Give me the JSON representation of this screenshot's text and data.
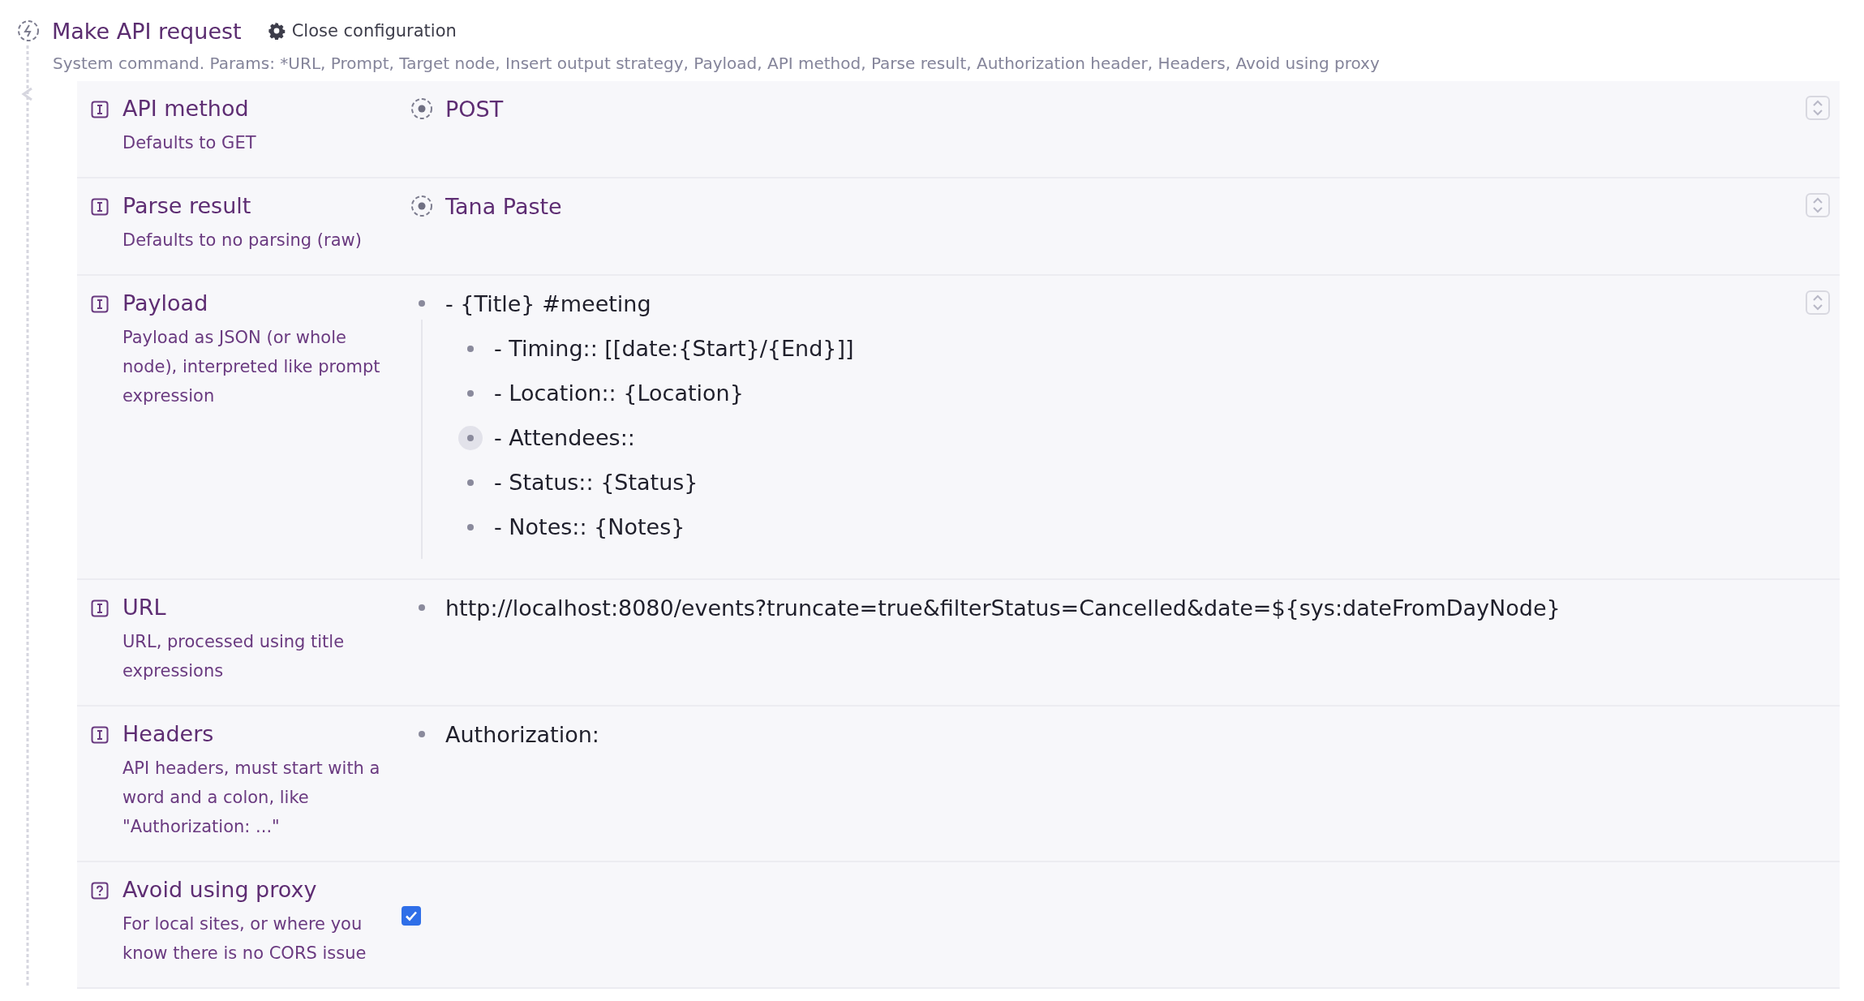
{
  "command": {
    "title": "Make API request",
    "config_button": "Close configuration",
    "description": "System command. Params: *URL, Prompt, Target node, Insert output strategy, Payload, API method, Parse result, Authorization header, Headers, Avoid using proxy"
  },
  "fields": [
    {
      "kind": "option",
      "label": "API method",
      "hint": "Defaults to GET",
      "value": "POST",
      "expander": true
    },
    {
      "kind": "option",
      "label": "Parse result",
      "hint": "Defaults to no parsing (raw)",
      "value": "Tana Paste",
      "expander": true
    },
    {
      "kind": "nodes",
      "label": "Payload",
      "hint": "Payload as JSON (or whole node), interpreted like prompt expression",
      "expander": true,
      "nodes": [
        {
          "text": "- {Title} #meeting",
          "highlighted": false,
          "children": [
            {
              "text": "- Timing:: [[date:{Start}/{End}]]",
              "highlighted": false
            },
            {
              "text": "- Location:: {Location}",
              "highlighted": false
            },
            {
              "text": "- Attendees::",
              "highlighted": true
            },
            {
              "text": "- Status:: {Status}",
              "highlighted": false
            },
            {
              "text": "- Notes:: {Notes}",
              "highlighted": false
            }
          ]
        }
      ]
    },
    {
      "kind": "nodes",
      "label": "URL",
      "hint": "URL, processed using title expressions",
      "expander": false,
      "nodes": [
        {
          "text": "http://localhost:8080/events?truncate=true&filterStatus=Cancelled&date=${sys:dateFromDayNode}",
          "highlighted": false
        }
      ]
    },
    {
      "kind": "nodes",
      "label": "Headers",
      "hint": "API headers, must start with a word and a colon, like \"Authorization: ...\"",
      "expander": false,
      "nodes": [
        {
          "text": "Authorization:",
          "highlighted": false
        }
      ]
    },
    {
      "kind": "checkbox",
      "label": "Avoid using proxy",
      "hint": "For local sites, or where you know there is no CORS issue",
      "checked": true,
      "expander": false
    }
  ]
}
